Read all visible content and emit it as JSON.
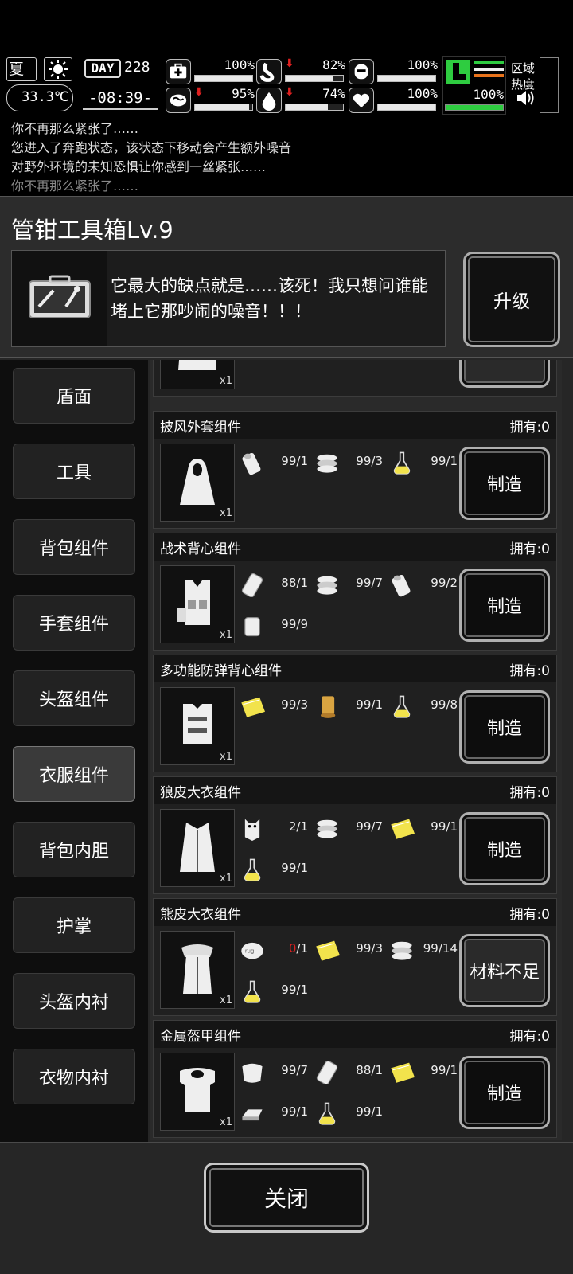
{
  "hud": {
    "season": "夏",
    "temperature": "33.3℃",
    "day_label": "DAY",
    "day_number": "228",
    "time": "-08:39-",
    "stats": [
      {
        "icon": "medkit-icon",
        "value": "100%",
        "level": 1.0,
        "down": false
      },
      {
        "icon": "stomach-icon",
        "value": "82%",
        "level": 0.82,
        "down": true
      },
      {
        "icon": "armor-icon",
        "value": "100%",
        "level": 1.0,
        "down": false
      },
      {
        "icon": "brain-icon",
        "value": "95%",
        "level": 0.95,
        "down": true
      },
      {
        "icon": "water-drop-icon",
        "value": "74%",
        "level": 0.74,
        "down": true
      },
      {
        "icon": "heart-icon",
        "value": "100%",
        "level": 1.0,
        "down": false
      }
    ],
    "body_status": "100%",
    "region_label": "区域热度"
  },
  "log": [
    {
      "text": "你不再那么紧张了……"
    },
    {
      "text": "您进入了奔跑状态，该状态下移动会产生额外噪音"
    },
    {
      "text": "对野外环境的未知恐惧让你感到一丝紧张……"
    },
    {
      "text": "你不再那么紧张了……"
    }
  ],
  "panel": {
    "title": "管钳工具箱Lv.9",
    "description": "它最大的缺点就是……该死！我只想问谁能堵上它那吵闹的噪音！！！",
    "upgrade_label": "升级"
  },
  "categories": [
    {
      "label": "盾面",
      "active": false
    },
    {
      "label": "工具",
      "active": false
    },
    {
      "label": "背包组件",
      "active": false
    },
    {
      "label": "手套组件",
      "active": false
    },
    {
      "label": "头盔组件",
      "active": false
    },
    {
      "label": "衣服组件",
      "active": true
    },
    {
      "label": "背包内胆",
      "active": false
    },
    {
      "label": "护掌",
      "active": false
    },
    {
      "label": "头盔内衬",
      "active": false
    },
    {
      "label": "衣物内衬",
      "active": false
    }
  ],
  "recipes_partial": {
    "qty": "x1",
    "button": "材料不足"
  },
  "recipes": [
    {
      "name": "披风外套组件",
      "owned": "拥有:0",
      "qty": "x1",
      "icon": "cloak-icon",
      "button": "制造",
      "enabled": true,
      "materials": [
        {
          "icon": "cloth-roll-icon",
          "have": "99",
          "need": "/1"
        },
        {
          "icon": "thread-icon",
          "have": "99",
          "need": "/3"
        },
        {
          "icon": "flask-icon",
          "have": "99",
          "need": "/1"
        }
      ]
    },
    {
      "name": "战术背心组件",
      "owned": "拥有:0",
      "qty": "x1",
      "icon": "tactical-vest-icon",
      "button": "制造",
      "enabled": true,
      "materials": [
        {
          "icon": "leather-icon",
          "have": "88",
          "need": "/1"
        },
        {
          "icon": "thread-icon",
          "have": "99",
          "need": "/7"
        },
        {
          "icon": "cloth-roll-icon",
          "have": "99",
          "need": "/2"
        },
        {
          "icon": "plate-icon",
          "have": "99",
          "need": "/9"
        }
      ]
    },
    {
      "name": "多功能防弹背心组件",
      "owned": "拥有:0",
      "qty": "x1",
      "icon": "bulletproof-vest-icon",
      "button": "制造",
      "enabled": true,
      "materials": [
        {
          "icon": "fabric-icon",
          "have": "99",
          "need": "/3"
        },
        {
          "icon": "spool-icon",
          "have": "99",
          "need": "/1"
        },
        {
          "icon": "flask-icon",
          "have": "99",
          "need": "/8"
        }
      ]
    },
    {
      "name": "狼皮大衣组件",
      "owned": "拥有:0",
      "qty": "x1",
      "icon": "wolf-coat-icon",
      "button": "制造",
      "enabled": true,
      "materials": [
        {
          "icon": "wolf-pelt-icon",
          "have": "2",
          "need": "/1"
        },
        {
          "icon": "thread-icon",
          "have": "99",
          "need": "/7"
        },
        {
          "icon": "fabric-icon",
          "have": "99",
          "need": "/1"
        },
        {
          "icon": "flask-icon",
          "have": "99",
          "need": "/1"
        }
      ]
    },
    {
      "name": "熊皮大衣组件",
      "owned": "拥有:0",
      "qty": "x1",
      "icon": "bear-coat-icon",
      "button": "材料不足",
      "enabled": false,
      "materials": [
        {
          "icon": "bear-pelt-icon",
          "have": "0",
          "need": "/1",
          "lacking": true
        },
        {
          "icon": "fabric-icon",
          "have": "99",
          "need": "/3"
        },
        {
          "icon": "thread-icon",
          "have": "99",
          "need": "/14"
        },
        {
          "icon": "flask-icon",
          "have": "99",
          "need": "/1"
        }
      ]
    },
    {
      "name": "金属盔甲组件",
      "owned": "拥有:0",
      "qty": "x1",
      "icon": "metal-armor-icon",
      "button": "制造",
      "enabled": true,
      "materials": [
        {
          "icon": "pelt-icon",
          "have": "99",
          "need": "/7"
        },
        {
          "icon": "leather-icon",
          "have": "88",
          "need": "/1"
        },
        {
          "icon": "fabric-icon",
          "have": "99",
          "need": "/1"
        },
        {
          "icon": "metal-ingot-icon",
          "have": "99",
          "need": "/1"
        },
        {
          "icon": "flask-icon",
          "have": "99",
          "need": "/1"
        }
      ]
    }
  ],
  "footer": {
    "close_label": "关闭"
  },
  "colors": {
    "accent_green": "#2ecc40",
    "warning_red": "#e02020",
    "potion_yellow": "#f2e34c"
  }
}
